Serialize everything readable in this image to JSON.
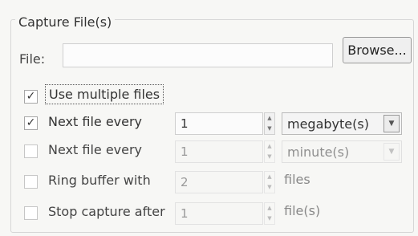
{
  "group": {
    "title": "Capture File(s)"
  },
  "file": {
    "label": "File:",
    "value": "",
    "browse_label": "Browse..."
  },
  "use_multiple": {
    "label": "Use multiple files",
    "checked": true,
    "check_mark": "✓"
  },
  "next_file_size": {
    "label": "Next file every",
    "checked": true,
    "check_mark": "✓",
    "value": "1",
    "unit": "megabyte(s)"
  },
  "next_file_time": {
    "label": "Next file every",
    "checked": false,
    "check_mark": "",
    "value": "1",
    "unit": "minute(s)"
  },
  "ring_buffer": {
    "label": "Ring buffer with",
    "checked": false,
    "check_mark": "",
    "value": "2",
    "unit": "files"
  },
  "stop_capture": {
    "label": "Stop capture after",
    "checked": false,
    "check_mark": "",
    "value": "1",
    "unit": "file(s)"
  },
  "icons": {
    "spin_up": "▲",
    "spin_down": "▼",
    "dropdown": "▼"
  }
}
